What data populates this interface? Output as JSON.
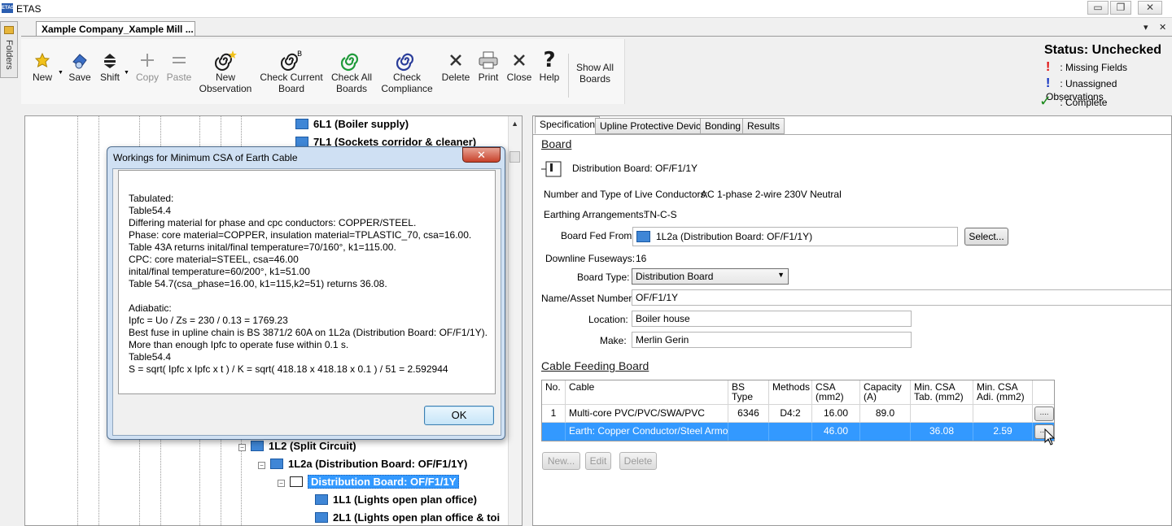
{
  "window": {
    "app_badge": "ETAS",
    "title": "ETAS",
    "controls": [
      "▭",
      "❐",
      "✕"
    ]
  },
  "folders": {
    "label": "Folders"
  },
  "doc_tab": {
    "label": "Xample Company_Xample Mill ...",
    "dropdown": "▾",
    "close": "✕"
  },
  "ribbon": {
    "new": "New",
    "save": "Save",
    "shift": "Shift",
    "copy": "Copy",
    "paste": "Paste",
    "new_observation": "New Observation",
    "check_current_board": "Check Current Board",
    "check_all_boards": "Check All Boards",
    "check_compliance": "Check Compliance",
    "delete": "Delete",
    "print": "Print",
    "close": "Close",
    "help": "Help",
    "show_all_boards": "Show All Boards"
  },
  "status": {
    "title": "Status: Unchecked",
    "legend": [
      {
        "mark": "!",
        "label": ": Missing Fields",
        "color": "#e01010"
      },
      {
        "mark": "!",
        "label": ": Unassigned Observations",
        "color": "#1030c0"
      },
      {
        "mark": "✓",
        "label": ": Complete",
        "color": "#1a8a1a"
      }
    ]
  },
  "tree": {
    "nodes": [
      {
        "label": "6L1 (Boiler supply)"
      },
      {
        "label": "7L1 (Sockets corridor & cleaner)"
      },
      {
        "label": "1L2 (Split Circuit)"
      },
      {
        "label": "1L2a (Distribution Board: OF/F1/1Y)"
      },
      {
        "label": "Distribution Board: OF/F1/1Y"
      },
      {
        "label": "1L1 (Lights open plan office)"
      },
      {
        "label": "2L1 (Lights open plan office & toi"
      }
    ]
  },
  "tabs": [
    "Specification",
    "Upline Protective Device",
    "Bonding",
    "Results"
  ],
  "board": {
    "heading": "Board",
    "name_line": "Distribution Board: OF/F1/1Y",
    "live_conductors_label": "Number and Type of Live Conductors:",
    "live_conductors_value": "AC 1-phase 2-wire 230V Neutral",
    "earthing_label": "Earthing Arrangements:",
    "earthing_value": "TN-C-S",
    "fed_from_label": "Board Fed From:",
    "fed_from_value": "1L2a (Distribution Board: OF/F1/1Y)",
    "select_button": "Select...",
    "downline_label": "Downline Fuseways:",
    "downline_value": "16",
    "board_type_label": "Board Type:",
    "board_type_value": "Distribution Board",
    "name_label": "Name/Asset Number:",
    "name_value": "OF/F1/1Y",
    "location_label": "Location:",
    "location_value": "Boiler house",
    "make_label": "Make:",
    "make_value": "Merlin Gerin"
  },
  "cable": {
    "heading": "Cable Feeding Board",
    "columns": [
      "No.",
      "Cable",
      "BS Type",
      "Methods",
      "CSA (mm2)",
      "Capacity (A)",
      "Min. CSA Tab. (mm2)",
      "Min. CSA Adi. (mm2)"
    ],
    "rows": [
      {
        "no": "1",
        "cable": "Multi-core PVC/PVC/SWA/PVC",
        "bs_type": "6346",
        "methods": "D4:2",
        "csa": "16.00",
        "capacity": "89.0",
        "min_tab": "",
        "min_adi": "",
        "btn": "...."
      },
      {
        "no": "",
        "cable": "Earth: Copper Conductor/Steel Armour**",
        "bs_type": "",
        "methods": "",
        "csa": "46.00",
        "capacity": "",
        "min_tab": "36.08",
        "min_adi": "2.59",
        "btn": "...."
      }
    ],
    "new_button": "New...",
    "edit_button": "Edit",
    "delete_button": "Delete"
  },
  "dialog": {
    "title": "Workings for Minimum CSA of Earth Cable",
    "close": "✕",
    "text": "Tabulated:\nTable54.4\nDiffering material for phase and cpc conductors: COPPER/STEEL.\nPhase: core material=COPPER, insulation material=TPLASTIC_70, csa=16.00.\nTable 43A returns inital/final temperature=70/160°, k1=115.00.\nCPC: core material=STEEL, csa=46.00\ninital/final temperature=60/200°, k1=51.00\nTable 54.7(csa_phase=16.00, k1=115,k2=51) returns 36.08.\n\nAdiabatic:\nIpfc = Uo / Zs = 230 / 0.13 = 1769.23\nBest fuse in upline chain is BS 3871/2 60A on 1L2a (Distribution Board: OF/F1/1Y).\nMore than enough Ipfc to operate fuse within 0.1 s.\nTable54.4\nS = sqrt( Ipfc x Ipfc x t ) / K = sqrt( 418.18 x 418.18 x 0.1 ) / 51 = 2.592944",
    "ok": "OK"
  }
}
